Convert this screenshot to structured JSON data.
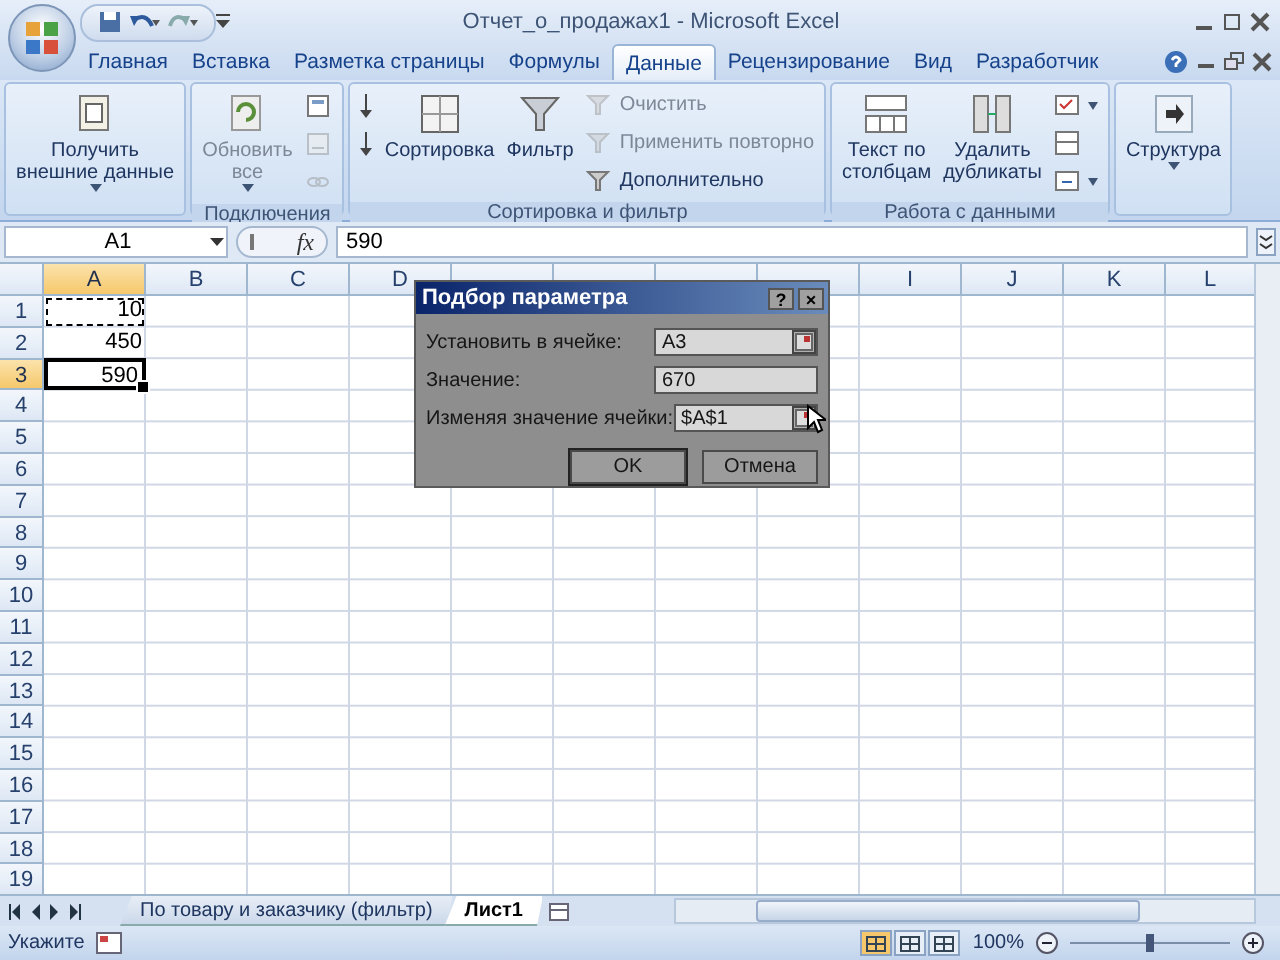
{
  "window": {
    "title": "Отчет_о_продажах1 - Microsoft Excel"
  },
  "ribbon_tabs": [
    {
      "label": "Главная",
      "selected": false
    },
    {
      "label": "Вставка",
      "selected": false
    },
    {
      "label": "Разметка страницы",
      "selected": false
    },
    {
      "label": "Формулы",
      "selected": false
    },
    {
      "label": "Данные",
      "selected": true
    },
    {
      "label": "Рецензирование",
      "selected": false
    },
    {
      "label": "Вид",
      "selected": false
    },
    {
      "label": "Разработчик",
      "selected": false
    }
  ],
  "ribbon_groups": [
    {
      "items": [
        {
          "kind": "large",
          "label": "Получить\nвнешние данные",
          "dropdown": true,
          "disabled": false
        }
      ]
    },
    {
      "label": "Подключения",
      "items": [
        {
          "kind": "large",
          "label": "Обновить\nвсе",
          "dropdown": true,
          "disabled": true
        },
        {
          "kind": "icon",
          "disabled": false
        },
        {
          "kind": "icon",
          "disabled": true
        },
        {
          "kind": "icon",
          "disabled": true
        }
      ]
    },
    {
      "label": "Сортировка и фильтр",
      "items": [
        {
          "kind": "icon",
          "disabled": false
        },
        {
          "kind": "icon",
          "disabled": false
        },
        {
          "kind": "large",
          "label": "Сортировка",
          "disabled": false
        },
        {
          "kind": "large",
          "label": "Фильтр",
          "disabled": false
        },
        {
          "kind": "small",
          "label": "Очистить",
          "disabled": true
        },
        {
          "kind": "small",
          "label": "Применить повторно",
          "disabled": true
        },
        {
          "kind": "small",
          "label": "Дополнительно",
          "disabled": false
        }
      ]
    },
    {
      "label": "Работа с данными",
      "items": [
        {
          "kind": "large",
          "label": "Текст по\nстолбцам",
          "disabled": false
        },
        {
          "kind": "large",
          "label": "Удалить\nдубликаты",
          "disabled": false
        },
        {
          "kind": "icon",
          "dropdown": true,
          "disabled": false
        },
        {
          "kind": "icon",
          "disabled": false
        },
        {
          "kind": "icon",
          "dropdown": true,
          "disabled": false
        }
      ]
    },
    {
      "items": [
        {
          "kind": "large",
          "label": "Структура",
          "dropdown": true,
          "disabled": false
        }
      ]
    }
  ],
  "formula_bar": {
    "name_box": "A1",
    "function_label": "fx",
    "value": "590"
  },
  "sheet": {
    "columns_left": [
      {
        "label": "A",
        "selected": true
      },
      {
        "label": "B",
        "selected": false
      },
      {
        "label": "C",
        "selected": false
      },
      {
        "label": "D",
        "selected": false
      }
    ],
    "columns_right": [
      {
        "label": "I",
        "selected": false
      },
      {
        "label": "J",
        "selected": false
      },
      {
        "label": "K",
        "selected": false
      },
      {
        "label": "L",
        "selected": false
      }
    ],
    "rows": [
      {
        "number": "1",
        "value": "10",
        "selected": false,
        "copied": true,
        "active": false
      },
      {
        "number": "2",
        "value": "450",
        "selected": false,
        "copied": false,
        "active": false
      },
      {
        "number": "3",
        "value": "590",
        "selected": true,
        "copied": false,
        "active": true
      },
      {
        "number": "4"
      },
      {
        "number": "5"
      },
      {
        "number": "6"
      },
      {
        "number": "7"
      },
      {
        "number": "8"
      },
      {
        "number": "9"
      },
      {
        "number": "10"
      },
      {
        "number": "11"
      },
      {
        "number": "12"
      },
      {
        "number": "13"
      },
      {
        "number": "14"
      },
      {
        "number": "15"
      },
      {
        "number": "16"
      },
      {
        "number": "17"
      },
      {
        "number": "18"
      },
      {
        "number": "19"
      }
    ]
  },
  "dialog": {
    "title": "Подбор параметра",
    "help": "?",
    "close": "×",
    "fields": [
      {
        "label": "Установить в ячейке:",
        "value": "A3",
        "kind": "reference"
      },
      {
        "label": "Значение:",
        "value": "670",
        "kind": "text"
      },
      {
        "label": "Изменяя значение ячейки:",
        "value": "$A$1",
        "kind": "reference"
      }
    ],
    "buttons": [
      {
        "label": "OK",
        "default": true
      },
      {
        "label": "Отмена",
        "default": false
      }
    ]
  },
  "sheet_tabs": [
    {
      "label": "По товару и заказчику (фильтр)",
      "selected": false
    },
    {
      "label": "Лист1",
      "selected": true
    }
  ],
  "status_bar": {
    "mode": "Укажите",
    "zoom": "100%",
    "zoom_level": {
      "level": 0.5
    },
    "views": [
      {
        "selected": true
      },
      {
        "selected": false
      },
      {
        "selected": false
      }
    ]
  }
}
